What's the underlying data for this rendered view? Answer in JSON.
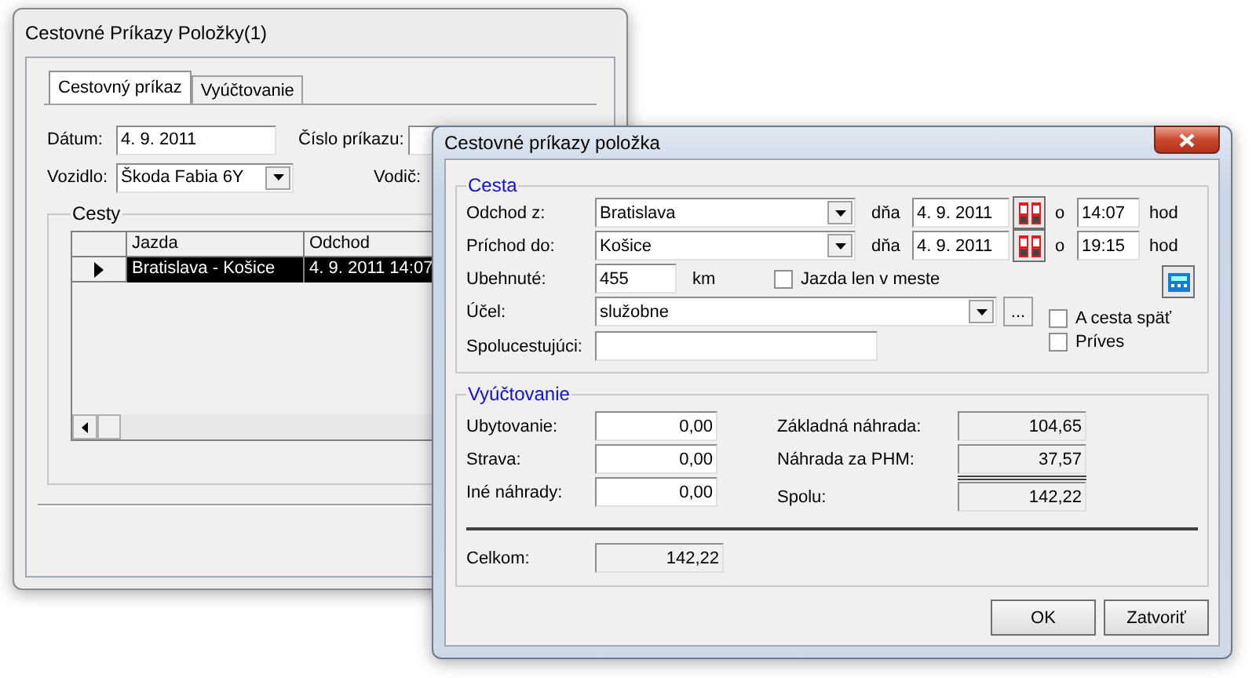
{
  "back_window": {
    "title": "Cestovné Príkazy Položky(1)",
    "tabs": [
      {
        "label": "Cestovný príkaz",
        "selected": true
      },
      {
        "label": "Vyúčtovanie",
        "selected": false
      }
    ],
    "datum": {
      "label": "Dátum:",
      "value": "4. 9. 2011"
    },
    "cislo": {
      "label": "Číslo príkazu:"
    },
    "vozidlo": {
      "label": "Vozidlo:",
      "value": "Škoda Fabia 6Y"
    },
    "vodic": {
      "label": "Vodič:"
    },
    "cesty": {
      "title": "Cesty",
      "columns": [
        "Jazda",
        "Odchod"
      ],
      "rows": [
        {
          "cells": [
            "Bratislava - Košice",
            "4. 9. 2011  14:07"
          ],
          "selected": true
        }
      ]
    }
  },
  "dialog": {
    "title": "Cestovné príkazy položka",
    "cesta": {
      "title": "Cesta",
      "legs": [
        {
          "label": "Odchod z:",
          "value": "Bratislava",
          "day_label": "dňa",
          "date": "4. 9. 2011",
          "at_label": "o",
          "time": "14:07",
          "unit": "hod"
        },
        {
          "label": "Príchod do:",
          "value": "Košice",
          "day_label": "dňa",
          "date": "4. 9. 2011",
          "at_label": "o",
          "time": "19:15",
          "unit": "hod"
        }
      ],
      "ubehnute": {
        "label": "Ubehnuté:",
        "value": "455",
        "unit": "km"
      },
      "jazda_mesto": {
        "label": "Jazda len v meste",
        "checked": false
      },
      "ucel": {
        "label": "Účel:",
        "value": "služobne",
        "more": "..."
      },
      "a_cesta": {
        "label": "A cesta späť",
        "checked": false
      },
      "prives": {
        "label": "Príves",
        "checked": false
      },
      "spolucestujuci": {
        "label": "Spolucestujúci:"
      }
    },
    "vyuctovanie": {
      "title": "Vyúčtovanie",
      "left": [
        {
          "label": "Ubytovanie:",
          "value": "0,00"
        },
        {
          "label": "Strava:",
          "value": "0,00"
        },
        {
          "label": "Iné náhrady:",
          "value": "0,00"
        }
      ],
      "right": [
        {
          "label": "Základná náhrada:",
          "value": "104,65"
        },
        {
          "label": "Náhrada za PHM:",
          "value": "37,57"
        },
        {
          "label": "Spolu:",
          "value": "142,22"
        }
      ],
      "total": {
        "label": "Celkom:",
        "value": "142,22"
      }
    },
    "buttons": [
      "OK",
      "Zatvoriť"
    ]
  }
}
